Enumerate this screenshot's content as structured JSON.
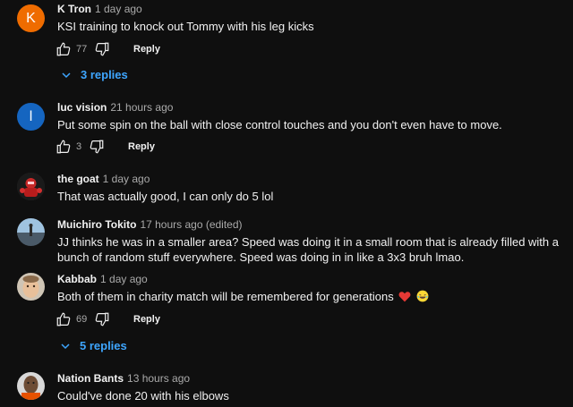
{
  "comments": [
    {
      "author": "K Tron",
      "time": "1 day ago",
      "text": "KSI training to knock out Tommy with his leg kicks",
      "avatar_letter": "K",
      "avatar_color": "#ef6c00",
      "likes": "77",
      "reply_label": "Reply",
      "replies_label": "3 replies"
    },
    {
      "author": "luc vision",
      "time": "21 hours ago",
      "text": "Put some spin on the ball with  close control touches and you don't even have to move.",
      "avatar_letter": "l",
      "avatar_color": "#1565c0",
      "likes": "3",
      "reply_label": "Reply"
    },
    {
      "author": "the goat",
      "time": "1 day ago",
      "text": "That was actually good, I can only do 5 lol"
    },
    {
      "author": "Muichiro Tokito",
      "time": "17 hours ago (edited)",
      "text": "JJ thinks he was in a smaller area? Speed was doing it in a small room that is already filled with a bunch of random stuff everywhere. Speed was doing in in like a 3x3 bruh lmao."
    },
    {
      "author": "Kabbab",
      "time": "1 day ago",
      "text": "Both of them in charity match will be remembered for generations",
      "likes": "69",
      "reply_label": "Reply",
      "replies_label": "5 replies"
    },
    {
      "author": "Nation Bants",
      "time": "13 hours ago",
      "text": "Could've done 20 with his elbows"
    }
  ],
  "colors": {
    "background": "#0f0f0f",
    "link_blue": "#3ea6ff",
    "secondary_text": "#aaaaaa"
  }
}
